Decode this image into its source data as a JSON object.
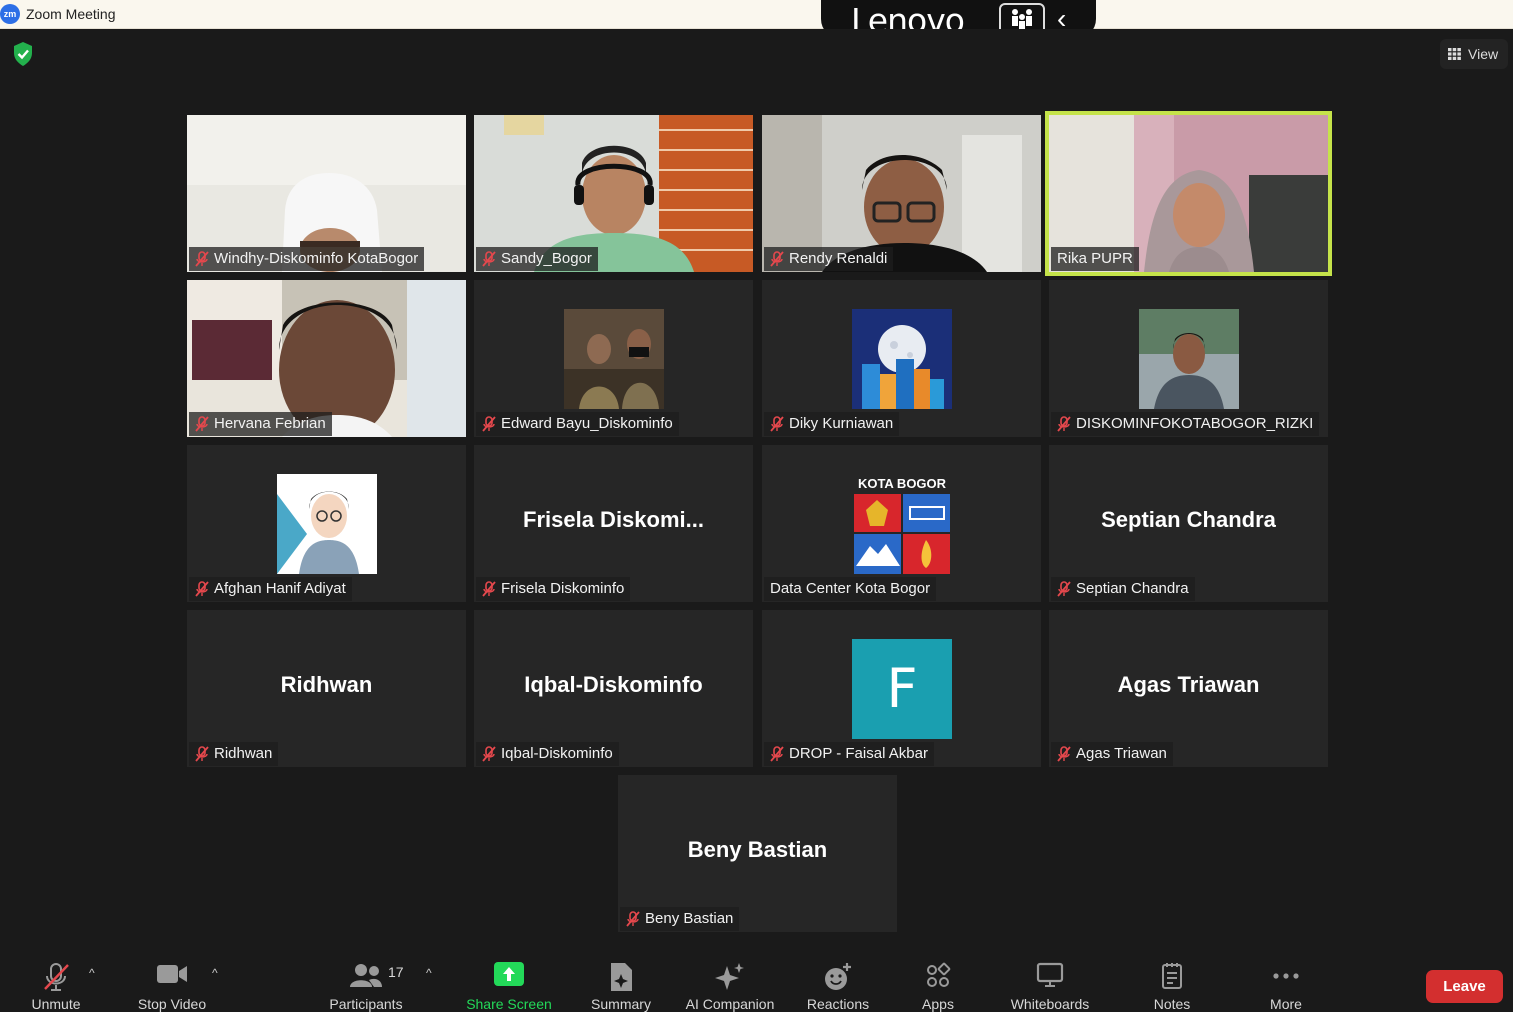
{
  "window": {
    "app_icon_text": "zm",
    "title": "Zoom Meeting",
    "overlay_brand": "Lenovo"
  },
  "view_button": {
    "label": "View"
  },
  "participants": [
    {
      "name": "Windhy-Diskominfo KotaBogor",
      "muted": true,
      "video": "camera"
    },
    {
      "name": "Sandy_Bogor",
      "muted": true,
      "video": "camera"
    },
    {
      "name": "Rendy Renaldi",
      "muted": true,
      "video": "camera"
    },
    {
      "name": "Rika PUPR",
      "muted": false,
      "video": "camera",
      "active_speaker": true
    },
    {
      "name": "Hervana Febrian",
      "muted": true,
      "video": "camera"
    },
    {
      "name": "Edward Bayu_Diskominfo",
      "muted": true,
      "video": "avatar-photo"
    },
    {
      "name": "Diky Kurniawan",
      "muted": true,
      "video": "avatar-moon-city"
    },
    {
      "name": "DISKOMINFOKOTABOGOR_RIZKI",
      "muted": true,
      "video": "avatar-photo"
    },
    {
      "name": "Afghan Hanif Adiyat",
      "muted": true,
      "video": "avatar-illustration"
    },
    {
      "name": "Frisela Diskominfo",
      "muted": true,
      "video": "name-only",
      "display_name": "Frisela  Diskomi..."
    },
    {
      "name": "Data Center Kota Bogor",
      "muted": false,
      "video": "avatar-logo",
      "logo_text": "KOTA BOGOR"
    },
    {
      "name": "Septian Chandra",
      "muted": true,
      "video": "name-only",
      "display_name": "Septian Chandra"
    },
    {
      "name": "Ridhwan",
      "muted": true,
      "video": "name-only",
      "display_name": "Ridhwan"
    },
    {
      "name": "Iqbal-Diskominfo",
      "muted": true,
      "video": "name-only",
      "display_name": "Iqbal-Diskominfo"
    },
    {
      "name": "DROP - Faisal Akbar",
      "muted": true,
      "video": "avatar-letter",
      "letter": "F"
    },
    {
      "name": "Agas Triawan",
      "muted": true,
      "video": "name-only",
      "display_name": "Agas Triawan"
    },
    {
      "name": "Beny Bastian",
      "muted": true,
      "video": "name-only",
      "display_name": "Beny Bastian"
    }
  ],
  "toolbar": {
    "unmute": "Unmute",
    "stop_video": "Stop Video",
    "participants": "Participants",
    "participants_count": "17",
    "share_screen": "Share Screen",
    "summary": "Summary",
    "ai_companion": "AI Companion",
    "reactions": "Reactions",
    "apps": "Apps",
    "whiteboards": "Whiteboards",
    "notes": "Notes",
    "more": "More",
    "leave": "Leave"
  },
  "colors": {
    "background": "#1a1a1a",
    "tile": "#262626",
    "active_speaker": "#c5e34a",
    "share_screen": "#23d959",
    "leave": "#d32f2f",
    "muted_icon": "#e5484d",
    "letter_avatar": "#1a9fb0"
  }
}
